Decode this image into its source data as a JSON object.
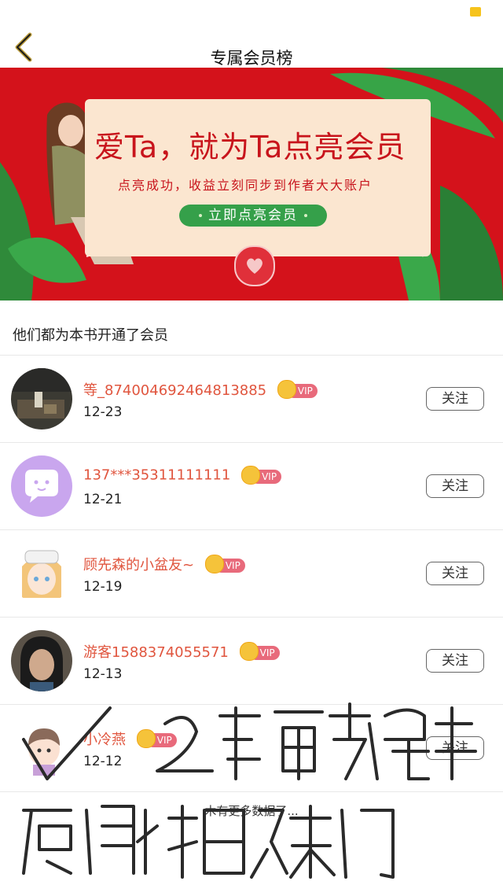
{
  "header": {
    "title": "专属会员榜"
  },
  "banner": {
    "headline": "爱Ta，就为Ta点亮会员",
    "subline": "点亮成功，收益立刻同步到作者大大账户",
    "cta": "立即点亮会员"
  },
  "section": {
    "title": "他们都为本书开通了会员"
  },
  "vip_label": "VIP",
  "follow_label": "关注",
  "members": [
    {
      "name": "等_874004692464813885",
      "date": "12-23"
    },
    {
      "name": "137***35311111111",
      "date": "12-21"
    },
    {
      "name": "顾先森的小盆友~",
      "date": "12-19"
    },
    {
      "name": "游客1588374055571",
      "date": "12-13"
    },
    {
      "name": "小冷燕",
      "date": "12-12"
    }
  ],
  "footer": {
    "no_more": "木有更多数据了..."
  },
  "overlay": {
    "line1": "✓ 2篇更新完毕",
    "line2": "感谢姐妹们"
  },
  "colors": {
    "banner_red": "#d4121b",
    "name_color": "#e0553e",
    "cta_green": "#35a04a",
    "vip_pink": "#e86a7b"
  }
}
